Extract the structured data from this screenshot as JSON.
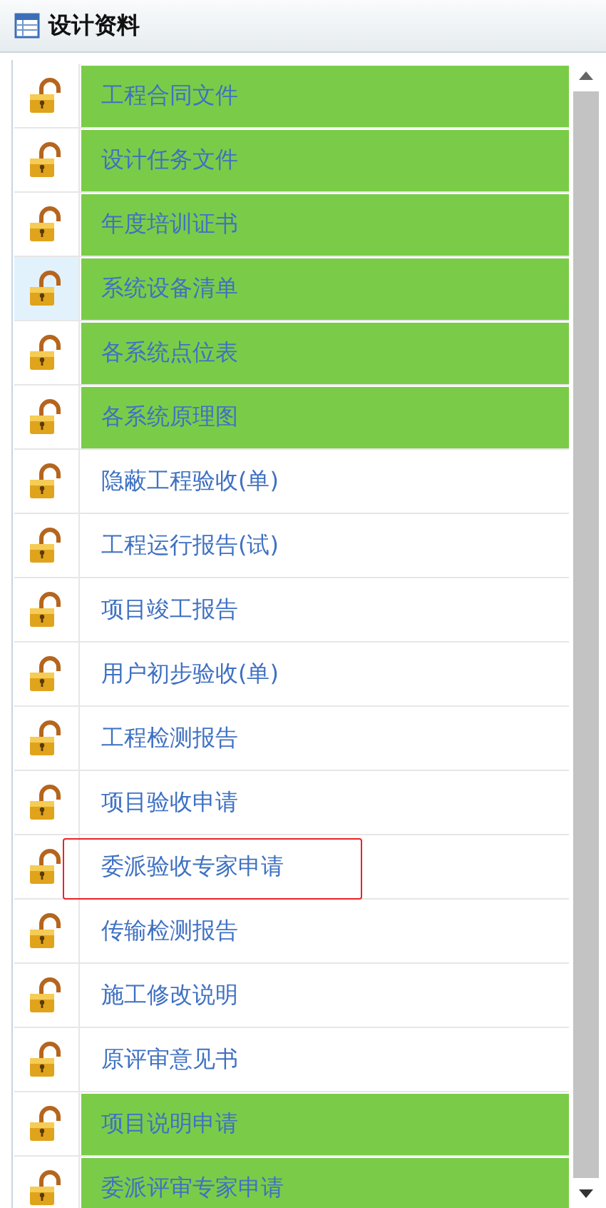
{
  "panel": {
    "title": "设计资料"
  },
  "rows": [
    {
      "label": "工程合同文件",
      "completed": true,
      "selected": false,
      "outlined": false
    },
    {
      "label": "设计任务文件",
      "completed": true,
      "selected": false,
      "outlined": false
    },
    {
      "label": "年度培训证书",
      "completed": true,
      "selected": false,
      "outlined": false
    },
    {
      "label": "系统设备清单",
      "completed": true,
      "selected": true,
      "outlined": false
    },
    {
      "label": "各系统点位表",
      "completed": true,
      "selected": false,
      "outlined": false
    },
    {
      "label": "各系统原理图",
      "completed": true,
      "selected": false,
      "outlined": false
    },
    {
      "label": "隐蔽工程验收(单)",
      "completed": false,
      "selected": false,
      "outlined": false
    },
    {
      "label": "工程运行报告(试)",
      "completed": false,
      "selected": false,
      "outlined": false
    },
    {
      "label": "项目竣工报告",
      "completed": false,
      "selected": false,
      "outlined": false
    },
    {
      "label": "用户初步验收(单)",
      "completed": false,
      "selected": false,
      "outlined": false
    },
    {
      "label": "工程检测报告",
      "completed": false,
      "selected": false,
      "outlined": false
    },
    {
      "label": "项目验收申请",
      "completed": false,
      "selected": false,
      "outlined": false
    },
    {
      "label": "委派验收专家申请",
      "completed": false,
      "selected": false,
      "outlined": true
    },
    {
      "label": "传输检测报告",
      "completed": false,
      "selected": false,
      "outlined": false
    },
    {
      "label": "施工修改说明",
      "completed": false,
      "selected": false,
      "outlined": false
    },
    {
      "label": "原评审意见书",
      "completed": false,
      "selected": false,
      "outlined": false
    },
    {
      "label": "项目说明申请",
      "completed": true,
      "selected": false,
      "outlined": false
    },
    {
      "label": "委派评审专家申请",
      "completed": true,
      "selected": false,
      "outlined": false
    }
  ]
}
